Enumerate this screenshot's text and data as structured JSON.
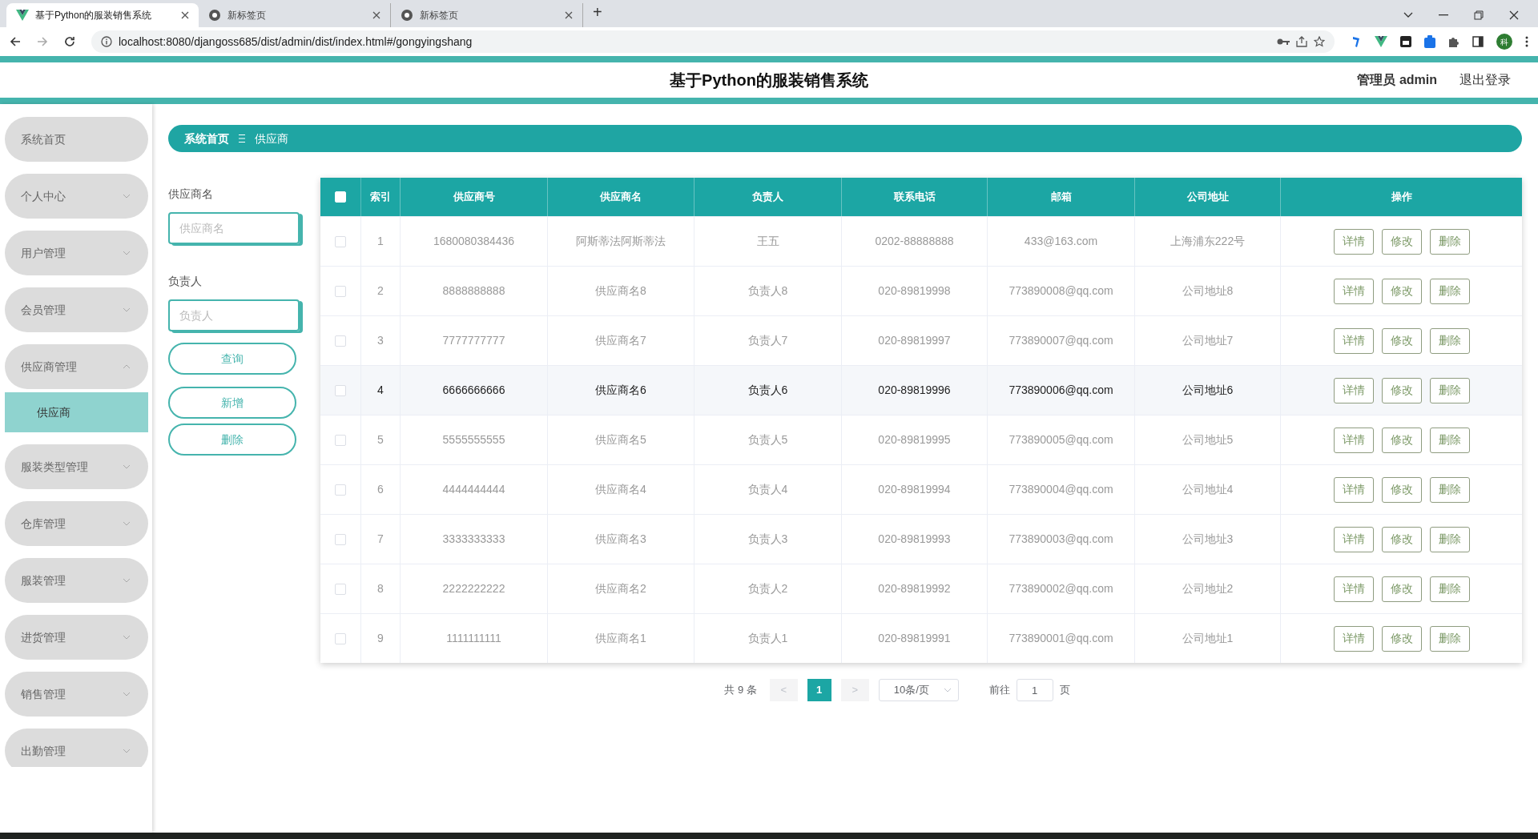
{
  "browser": {
    "tabs": [
      {
        "title": "基于Python的服装销售系统",
        "kind": "app",
        "selected": true
      },
      {
        "title": "新标签页",
        "kind": "chrome",
        "selected": false
      },
      {
        "title": "新标签页",
        "kind": "chrome",
        "selected": false
      }
    ],
    "new_tab": "+",
    "url": "localhost:8080/djangoss685/dist/admin/dist/index.html#/gongyingshang",
    "profile": "科"
  },
  "header": {
    "title": "基于Python的服装销售系统",
    "user": "管理员 admin",
    "logout": "退出登录"
  },
  "sidebar": {
    "items": [
      {
        "label": "系统首页",
        "kind": "link"
      },
      {
        "label": "个人中心",
        "kind": "menu",
        "expanded": false
      },
      {
        "label": "用户管理",
        "kind": "menu",
        "expanded": false
      },
      {
        "label": "会员管理",
        "kind": "menu",
        "expanded": false
      },
      {
        "label": "供应商管理",
        "kind": "menu",
        "expanded": true,
        "children": [
          {
            "label": "供应商",
            "selected": true
          }
        ]
      },
      {
        "label": "服装类型管理",
        "kind": "menu",
        "expanded": false
      },
      {
        "label": "仓库管理",
        "kind": "menu",
        "expanded": false
      },
      {
        "label": "服装管理",
        "kind": "menu",
        "expanded": false
      },
      {
        "label": "进货管理",
        "kind": "menu",
        "expanded": false
      },
      {
        "label": "销售管理",
        "kind": "menu",
        "expanded": false
      },
      {
        "label": "出勤管理",
        "kind": "menu",
        "expanded": false
      }
    ]
  },
  "breadcrumb": [
    "系统首页",
    "供应商"
  ],
  "filters": [
    {
      "label": "供应商名",
      "placeholder": "供应商名"
    },
    {
      "label": "负责人",
      "placeholder": "负责人"
    }
  ],
  "buttons": [
    "查询",
    "新增",
    "删除"
  ],
  "table": {
    "header_checked": false,
    "columns": [
      "索引",
      "供应商号",
      "供应商名",
      "负责人",
      "联系电话",
      "邮箱",
      "公司地址",
      "操作"
    ],
    "rows": [
      {
        "checked": false,
        "highlighted": false,
        "cells": [
          "1",
          "1680080384436",
          "阿斯蒂法阿斯蒂法",
          "王五",
          "0202-88888888",
          "433@163.com",
          "上海浦东222号"
        ],
        "actions": [
          "详情",
          "修改",
          "删除"
        ]
      },
      {
        "checked": false,
        "highlighted": false,
        "cells": [
          "2",
          "8888888888",
          "供应商名8",
          "负责人8",
          "020-89819998",
          "773890008@qq.com",
          "公司地址8"
        ],
        "actions": [
          "详情",
          "修改",
          "删除"
        ]
      },
      {
        "checked": false,
        "highlighted": false,
        "cells": [
          "3",
          "7777777777",
          "供应商名7",
          "负责人7",
          "020-89819997",
          "773890007@qq.com",
          "公司地址7"
        ],
        "actions": [
          "详情",
          "修改",
          "删除"
        ]
      },
      {
        "checked": false,
        "highlighted": true,
        "cells": [
          "4",
          "6666666666",
          "供应商名6",
          "负责人6",
          "020-89819996",
          "773890006@qq.com",
          "公司地址6"
        ],
        "actions": [
          "详情",
          "修改",
          "删除"
        ]
      },
      {
        "checked": false,
        "highlighted": false,
        "cells": [
          "5",
          "5555555555",
          "供应商名5",
          "负责人5",
          "020-89819995",
          "773890005@qq.com",
          "公司地址5"
        ],
        "actions": [
          "详情",
          "修改",
          "删除"
        ]
      },
      {
        "checked": false,
        "highlighted": false,
        "cells": [
          "6",
          "4444444444",
          "供应商名4",
          "负责人4",
          "020-89819994",
          "773890004@qq.com",
          "公司地址4"
        ],
        "actions": [
          "详情",
          "修改",
          "删除"
        ]
      },
      {
        "checked": false,
        "highlighted": false,
        "cells": [
          "7",
          "3333333333",
          "供应商名3",
          "负责人3",
          "020-89819993",
          "773890003@qq.com",
          "公司地址3"
        ],
        "actions": [
          "详情",
          "修改",
          "删除"
        ]
      },
      {
        "checked": false,
        "highlighted": false,
        "cells": [
          "8",
          "2222222222",
          "供应商名2",
          "负责人2",
          "020-89819992",
          "773890002@qq.com",
          "公司地址2"
        ],
        "actions": [
          "详情",
          "修改",
          "删除"
        ]
      },
      {
        "checked": false,
        "highlighted": false,
        "cells": [
          "9",
          "1111111111",
          "供应商名1",
          "负责人1",
          "020-89819991",
          "773890001@qq.com",
          "公司地址1"
        ],
        "actions": [
          "详情",
          "修改",
          "删除"
        ]
      }
    ]
  },
  "pagination": {
    "total": "共 9 条",
    "prev": "<",
    "pages": [
      {
        "label": "1",
        "selected": true
      }
    ],
    "next": ">",
    "page_size": "10条/页",
    "goto_label": "前往",
    "goto_value": "1",
    "goto_suffix": "页"
  }
}
